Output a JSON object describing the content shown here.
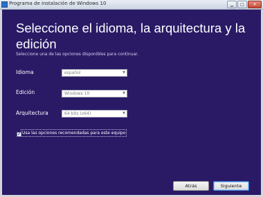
{
  "window": {
    "title": "Programa de instalación de Windows 10",
    "buttons": {
      "minimize": "▁",
      "maximize": "□",
      "close": "✕"
    }
  },
  "main": {
    "heading": "Seleccione el idioma, la arquitectura y la edición",
    "subtitle": "Seleccione una de las opciones disponibles para continuar.",
    "fields": [
      {
        "label": "Idioma",
        "value": "español"
      },
      {
        "label": "Edición",
        "value": "Windows 10"
      },
      {
        "label": "Arquitectura",
        "value": "64 bits (x64)"
      }
    ],
    "recommended": {
      "checked": true,
      "mark": "✔",
      "label": "Usa las opciones recomendadas para este equipo"
    }
  },
  "footer": {
    "back_label": "Atrás",
    "next_label": "Siguiente"
  },
  "colors": {
    "background": "#2a1a66",
    "text": "#ffffff",
    "field": "#ffffff"
  }
}
